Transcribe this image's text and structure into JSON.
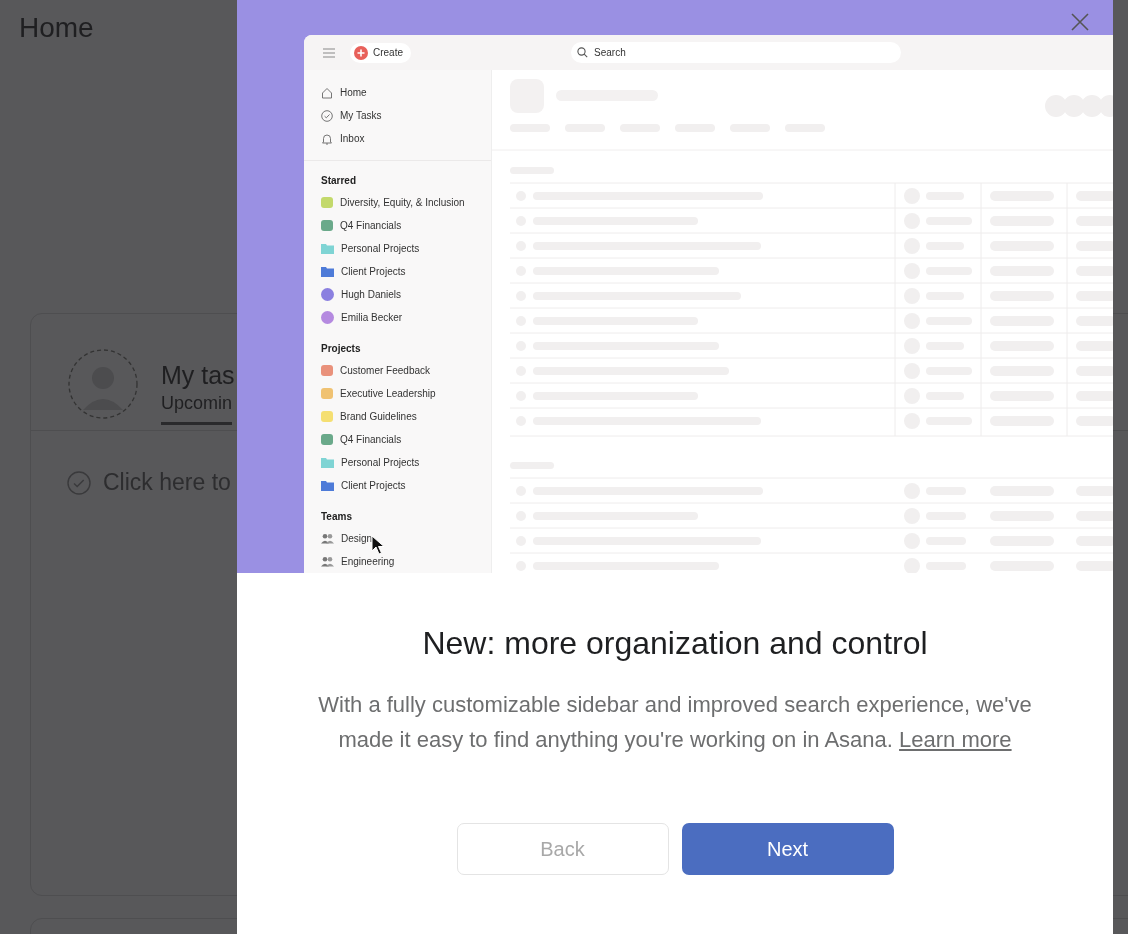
{
  "page": {
    "title": "Home",
    "my_tasks": {
      "title": "My tas",
      "tabs": [
        {
          "label": "Upcomin",
          "selected": true
        }
      ],
      "task_prompt": "Click here to"
    }
  },
  "modal": {
    "preview": {
      "create_button": "Create",
      "search": {
        "placeholder": "Search"
      },
      "nav_items": [
        {
          "label": "Home",
          "kind": "home"
        },
        {
          "label": "My Tasks",
          "kind": "tasks"
        },
        {
          "label": "Inbox",
          "kind": "inbox"
        }
      ],
      "sections": [
        {
          "title": "Starred",
          "items": [
            {
              "label": "Diversity, Equity, & Inclusion",
              "kind": "square",
              "color": "#c3d96b"
            },
            {
              "label": "Q4 Financials",
              "kind": "square",
              "color": "#6aa98a"
            },
            {
              "label": "Personal Projects",
              "kind": "folder",
              "color": "#7fd4d4"
            },
            {
              "label": "Client Projects",
              "kind": "folder",
              "color": "#4e7bd8"
            },
            {
              "label": "Hugh Daniels",
              "kind": "avatar",
              "color": "#8b80e0"
            },
            {
              "label": "Emilia Becker",
              "kind": "avatar",
              "color": "#b58ae0"
            }
          ]
        },
        {
          "title": "Projects",
          "items": [
            {
              "label": "Customer Feedback",
              "kind": "square",
              "color": "#e9917b"
            },
            {
              "label": "Executive Leadership",
              "kind": "square",
              "color": "#f0c272"
            },
            {
              "label": "Brand Guidelines",
              "kind": "square",
              "color": "#f5df72"
            },
            {
              "label": "Q4 Financials",
              "kind": "square",
              "color": "#6aa98a"
            },
            {
              "label": "Personal Projects",
              "kind": "folder",
              "color": "#7fd4d4"
            },
            {
              "label": "Client Projects",
              "kind": "folder",
              "color": "#4e7bd8"
            }
          ]
        },
        {
          "title": "Teams",
          "items": [
            {
              "label": "Design",
              "kind": "team"
            },
            {
              "label": "Engineering",
              "kind": "team"
            }
          ]
        }
      ]
    },
    "heading": "New: more organization and control",
    "body": "With a fully customizable sidebar and improved search experience, we've made it easy to find anything you're working on in Asana.",
    "link": "Learn more",
    "buttons": [
      {
        "label": "Back",
        "kind": "secondary",
        "disabled": true
      },
      {
        "label": "Next",
        "kind": "primary",
        "disabled": false
      }
    ]
  }
}
